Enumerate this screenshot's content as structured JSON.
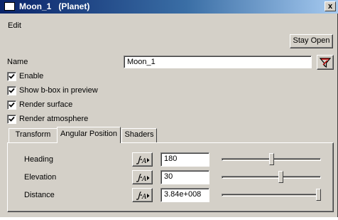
{
  "window": {
    "title": "Moon_1   (Planet)",
    "close_label": "x"
  },
  "menu": {
    "edit_label": "Edit"
  },
  "toolbar": {
    "stay_open_label": "Stay Open"
  },
  "name_field": {
    "label": "Name",
    "value": "Moon_1"
  },
  "checkboxes": [
    {
      "label": "Enable",
      "checked": true
    },
    {
      "label": "Show b-box in preview",
      "checked": true
    },
    {
      "label": "Render surface",
      "checked": true
    },
    {
      "label": "Render atmosphere",
      "checked": true
    }
  ],
  "tabs": [
    {
      "label": "Transform",
      "active": false
    },
    {
      "label": "Angular Position",
      "active": true
    },
    {
      "label": "Shaders",
      "active": false
    }
  ],
  "parameters": [
    {
      "label": "Heading",
      "value": "180",
      "slider_fraction": 0.5
    },
    {
      "label": "Elevation",
      "value": "30",
      "slider_fraction": 0.6
    },
    {
      "label": "Distance",
      "value": "3.84e+008",
      "slider_fraction": 1.0
    }
  ],
  "colors": {
    "titlebar_start": "#0a246a",
    "titlebar_end": "#a6caf0",
    "face": "#d4d0c8",
    "filter_icon_red": "#c00000"
  },
  "icons": {
    "filter": "funnel-icon",
    "animate": "spline-curve-icon"
  }
}
